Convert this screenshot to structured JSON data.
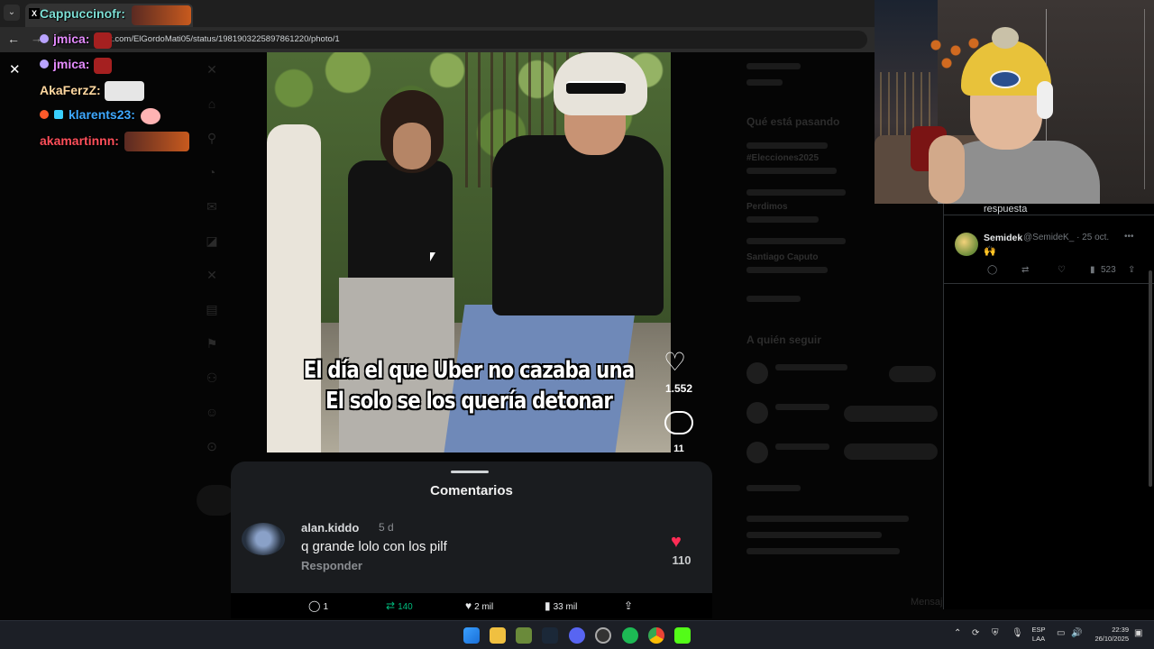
{
  "browser": {
    "url": "x.com/ElGordoMati05/status/1981903225897861220/photo/1"
  },
  "chat": [
    {
      "user": "Cappuccinofr:",
      "color": "#7ee0d6"
    },
    {
      "user": "jmica:",
      "color": "#e58cff"
    },
    {
      "user": "jmica:",
      "color": "#e58cff"
    },
    {
      "user": "AkaFerzZ:",
      "color": "#ffd8a0"
    },
    {
      "user": "klarents23:",
      "color": "#3ea8ff"
    },
    {
      "user": "akamartinnn:",
      "color": "#ff4f5a"
    }
  ],
  "video": {
    "caption_line1": "El día el que Uber no cazaba una",
    "caption_line2": "El solo se los quería detonar",
    "likes": "1.552",
    "comments": "11"
  },
  "comments_panel": {
    "title": "Comentarios",
    "user": "alan.kiddo",
    "age": "5 d",
    "text": "q grande lolo con los pilf",
    "reply": "Responder",
    "likes": "110"
  },
  "tweet_actions": {
    "replies": "1",
    "reposts": "140",
    "likes": "2 mil",
    "views": "33 mil"
  },
  "backdrop": {
    "trending_heading": "Qué está pasando",
    "follow_heading": "A quién seguir",
    "trends": [
      "#Elecciones2025",
      "Perdimos",
      "Santiago Caputo"
    ],
    "more_label": "Mensajes"
  },
  "reply_column": {
    "header_fragment": "respuesta",
    "name": "Semidek",
    "handle": "@SemideK_ · 25 oct.",
    "text": "🙌",
    "views": "523"
  },
  "taskbar": {
    "lang_top": "ESP",
    "lang_bottom": "LAA",
    "time": "22:39",
    "date": "26/10/2025"
  },
  "colors": {
    "accent_green": "#00ba7c",
    "tiktok_red": "#ff2c55"
  }
}
